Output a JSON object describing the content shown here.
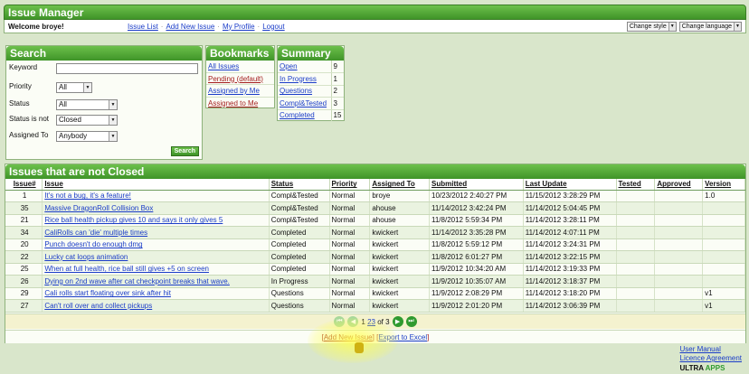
{
  "app": {
    "title": "Issue Manager",
    "welcome": "Welcome broye!"
  },
  "nav": [
    "Issue List",
    "Add New Issue",
    "My Profile",
    "Logout"
  ],
  "controls": {
    "style": "Change style",
    "language": "Change language"
  },
  "search": {
    "title": "Search",
    "fields": [
      {
        "label": "Keyword",
        "value": ""
      },
      {
        "label": "Priority",
        "value": "All"
      },
      {
        "label": "Status",
        "value": "All"
      },
      {
        "label": "Status is not",
        "value": "Closed"
      },
      {
        "label": "Assigned To",
        "value": "Anybody"
      }
    ],
    "button": "Search"
  },
  "bookmarks": {
    "title": "Bookmarks",
    "items": [
      "All Issues",
      "Pending (default)",
      "Assigned by Me",
      "Assigned to Me"
    ]
  },
  "summary": {
    "title": "Summary",
    "rows": [
      {
        "label": "Open",
        "count": "9"
      },
      {
        "label": "In Progress",
        "count": "1"
      },
      {
        "label": "Questions",
        "count": "2"
      },
      {
        "label": "Compl&Tested",
        "count": "3"
      },
      {
        "label": "Completed",
        "count": "15"
      }
    ]
  },
  "issues": {
    "title": "Issues that are not Closed",
    "columns": [
      "Issue#",
      "Issue",
      "Status",
      "Priority",
      "Assigned To",
      "Submitted",
      "Last Update",
      "Tested",
      "Approved",
      "Version"
    ],
    "rows": [
      [
        "1",
        "It's not a bug, it's a feature!",
        "Compl&Tested",
        "Normal",
        "broye",
        "10/23/2012 2:40:27 PM",
        "11/15/2012 3:28:29 PM",
        "",
        "",
        "1.0"
      ],
      [
        "35",
        "Massive DragonRoll Collision Box",
        "Compl&Tested",
        "Normal",
        "ahouse",
        "11/14/2012 3:42:24 PM",
        "11/14/2012 5:04:45 PM",
        "",
        "",
        ""
      ],
      [
        "21",
        "Rice ball health pickup gives 10 and says it only gives 5",
        "Compl&Tested",
        "Normal",
        "ahouse",
        "11/8/2012 5:59:34 PM",
        "11/14/2012 3:28:11 PM",
        "",
        "",
        ""
      ],
      [
        "34",
        "CaliRolls can 'die' multiple times",
        "Completed",
        "Normal",
        "kwickert",
        "11/14/2012 3:35:28 PM",
        "11/14/2012 4:07:11 PM",
        "",
        "",
        ""
      ],
      [
        "20",
        "Punch doesn't do enough dmg",
        "Completed",
        "Normal",
        "kwickert",
        "11/8/2012 5:59:12 PM",
        "11/14/2012 3:24:31 PM",
        "",
        "",
        ""
      ],
      [
        "22",
        "Lucky cat loops animation",
        "Completed",
        "Normal",
        "kwickert",
        "11/8/2012 6:01:27 PM",
        "11/14/2012 3:22:15 PM",
        "",
        "",
        ""
      ],
      [
        "25",
        "When at full health, rice ball still gives +5 on screen",
        "Completed",
        "Normal",
        "kwickert",
        "11/9/2012 10:34:20 AM",
        "11/14/2012 3:19:33 PM",
        "",
        "",
        ""
      ],
      [
        "26",
        "Dying on 2nd wave after cat checkpoint breaks that wave.",
        "In Progress",
        "Normal",
        "kwickert",
        "11/9/2012 10:35:07 AM",
        "11/14/2012 3:18:37 PM",
        "",
        "",
        ""
      ],
      [
        "29",
        "Cali rolls start floating over sink after hit",
        "Questions",
        "Normal",
        "kwickert",
        "11/9/2012 2:08:29 PM",
        "11/14/2012 3:18:20 PM",
        "",
        "",
        "v1"
      ],
      [
        "27",
        "Can't roll over and collect pickups",
        "Questions",
        "Normal",
        "kwickert",
        "11/9/2012 2:01:20 PM",
        "11/14/2012 3:06:39 PM",
        "",
        "",
        "v1"
      ]
    ]
  },
  "pager": {
    "pages": [
      "1",
      "2",
      "3"
    ],
    "of_text": "of 3"
  },
  "actions": {
    "add": "Add New Issue",
    "export": "Export to Excel"
  },
  "footer": {
    "manual": "User Manual",
    "license": "Licence Agreement",
    "logo_ultra": "ULTRA",
    "logo_apps": "APPS"
  }
}
